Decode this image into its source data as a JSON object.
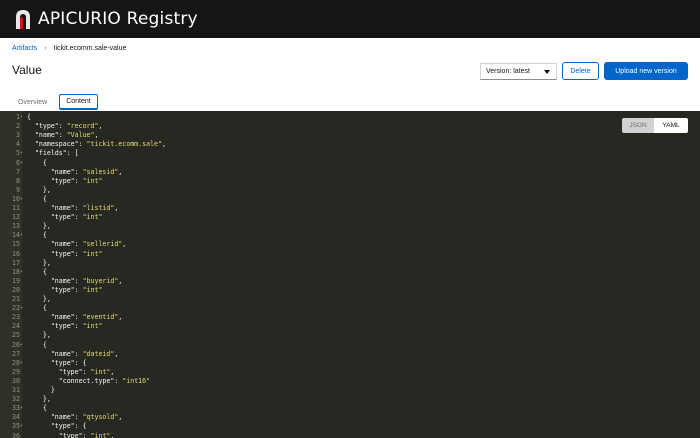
{
  "app": {
    "title": "APICURIO Registry"
  },
  "breadcrumb": {
    "root": "Artifacts",
    "current": "tickit.ecomm.sale-value"
  },
  "page": {
    "title": "Value"
  },
  "toolbar": {
    "version_label": "Version: latest",
    "delete_label": "Delete",
    "upload_label": "Upload new version"
  },
  "tabs": [
    {
      "label": "Overview",
      "active": false
    },
    {
      "label": "Content",
      "active": true
    }
  ],
  "format_toggle": {
    "json": "JSON",
    "yaml": "YAML",
    "selected": "JSON"
  },
  "editor": {
    "lines": [
      {
        "n": "1",
        "fold": true,
        "text": "{"
      },
      {
        "n": "2",
        "fold": false,
        "text": "  \"type\": \"record\","
      },
      {
        "n": "3",
        "fold": false,
        "text": "  \"name\": \"Value\","
      },
      {
        "n": "4",
        "fold": false,
        "text": "  \"namespace\": \"tickit.ecomm.sale\","
      },
      {
        "n": "5",
        "fold": true,
        "text": "  \"fields\": ["
      },
      {
        "n": "6",
        "fold": true,
        "text": "    {"
      },
      {
        "n": "7",
        "fold": false,
        "text": "      \"name\": \"salesid\","
      },
      {
        "n": "8",
        "fold": false,
        "text": "      \"type\": \"int\""
      },
      {
        "n": "9",
        "fold": false,
        "text": "    },"
      },
      {
        "n": "10",
        "fold": true,
        "text": "    {"
      },
      {
        "n": "11",
        "fold": false,
        "text": "      \"name\": \"listid\","
      },
      {
        "n": "12",
        "fold": false,
        "text": "      \"type\": \"int\""
      },
      {
        "n": "13",
        "fold": false,
        "text": "    },"
      },
      {
        "n": "14",
        "fold": true,
        "text": "    {"
      },
      {
        "n": "15",
        "fold": false,
        "text": "      \"name\": \"sellerid\","
      },
      {
        "n": "16",
        "fold": false,
        "text": "      \"type\": \"int\""
      },
      {
        "n": "17",
        "fold": false,
        "text": "    },"
      },
      {
        "n": "18",
        "fold": true,
        "text": "    {"
      },
      {
        "n": "19",
        "fold": false,
        "text": "      \"name\": \"buyerid\","
      },
      {
        "n": "20",
        "fold": false,
        "text": "      \"type\": \"int\""
      },
      {
        "n": "21",
        "fold": false,
        "text": "    },"
      },
      {
        "n": "22",
        "fold": true,
        "text": "    {"
      },
      {
        "n": "23",
        "fold": false,
        "text": "      \"name\": \"eventid\","
      },
      {
        "n": "24",
        "fold": false,
        "text": "      \"type\": \"int\""
      },
      {
        "n": "25",
        "fold": false,
        "text": "    },"
      },
      {
        "n": "26",
        "fold": true,
        "text": "    {"
      },
      {
        "n": "27",
        "fold": false,
        "text": "      \"name\": \"dateid\","
      },
      {
        "n": "28",
        "fold": true,
        "text": "      \"type\": {"
      },
      {
        "n": "29",
        "fold": false,
        "text": "        \"type\": \"int\","
      },
      {
        "n": "30",
        "fold": false,
        "text": "        \"connect.type\": \"int16\""
      },
      {
        "n": "31",
        "fold": false,
        "text": "      }"
      },
      {
        "n": "32",
        "fold": false,
        "text": "    },"
      },
      {
        "n": "33",
        "fold": true,
        "text": "    {"
      },
      {
        "n": "34",
        "fold": false,
        "text": "      \"name\": \"qtysold\","
      },
      {
        "n": "35",
        "fold": true,
        "text": "      \"type\": {"
      },
      {
        "n": "36",
        "fold": false,
        "text": "        \"type\": \"int\","
      }
    ]
  }
}
